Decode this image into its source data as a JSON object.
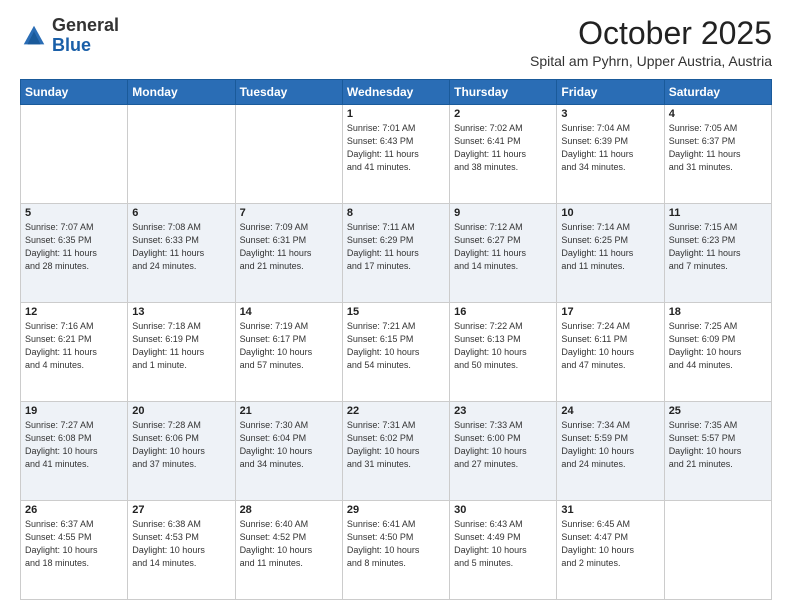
{
  "header": {
    "logo": {
      "general": "General",
      "blue": "Blue"
    },
    "title": "October 2025",
    "location": "Spital am Pyhrn, Upper Austria, Austria"
  },
  "calendar": {
    "days_of_week": [
      "Sunday",
      "Monday",
      "Tuesday",
      "Wednesday",
      "Thursday",
      "Friday",
      "Saturday"
    ],
    "weeks": [
      [
        {
          "day": "",
          "info": ""
        },
        {
          "day": "",
          "info": ""
        },
        {
          "day": "",
          "info": ""
        },
        {
          "day": "1",
          "info": "Sunrise: 7:01 AM\nSunset: 6:43 PM\nDaylight: 11 hours\nand 41 minutes."
        },
        {
          "day": "2",
          "info": "Sunrise: 7:02 AM\nSunset: 6:41 PM\nDaylight: 11 hours\nand 38 minutes."
        },
        {
          "day": "3",
          "info": "Sunrise: 7:04 AM\nSunset: 6:39 PM\nDaylight: 11 hours\nand 34 minutes."
        },
        {
          "day": "4",
          "info": "Sunrise: 7:05 AM\nSunset: 6:37 PM\nDaylight: 11 hours\nand 31 minutes."
        }
      ],
      [
        {
          "day": "5",
          "info": "Sunrise: 7:07 AM\nSunset: 6:35 PM\nDaylight: 11 hours\nand 28 minutes."
        },
        {
          "day": "6",
          "info": "Sunrise: 7:08 AM\nSunset: 6:33 PM\nDaylight: 11 hours\nand 24 minutes."
        },
        {
          "day": "7",
          "info": "Sunrise: 7:09 AM\nSunset: 6:31 PM\nDaylight: 11 hours\nand 21 minutes."
        },
        {
          "day": "8",
          "info": "Sunrise: 7:11 AM\nSunset: 6:29 PM\nDaylight: 11 hours\nand 17 minutes."
        },
        {
          "day": "9",
          "info": "Sunrise: 7:12 AM\nSunset: 6:27 PM\nDaylight: 11 hours\nand 14 minutes."
        },
        {
          "day": "10",
          "info": "Sunrise: 7:14 AM\nSunset: 6:25 PM\nDaylight: 11 hours\nand 11 minutes."
        },
        {
          "day": "11",
          "info": "Sunrise: 7:15 AM\nSunset: 6:23 PM\nDaylight: 11 hours\nand 7 minutes."
        }
      ],
      [
        {
          "day": "12",
          "info": "Sunrise: 7:16 AM\nSunset: 6:21 PM\nDaylight: 11 hours\nand 4 minutes."
        },
        {
          "day": "13",
          "info": "Sunrise: 7:18 AM\nSunset: 6:19 PM\nDaylight: 11 hours\nand 1 minute."
        },
        {
          "day": "14",
          "info": "Sunrise: 7:19 AM\nSunset: 6:17 PM\nDaylight: 10 hours\nand 57 minutes."
        },
        {
          "day": "15",
          "info": "Sunrise: 7:21 AM\nSunset: 6:15 PM\nDaylight: 10 hours\nand 54 minutes."
        },
        {
          "day": "16",
          "info": "Sunrise: 7:22 AM\nSunset: 6:13 PM\nDaylight: 10 hours\nand 50 minutes."
        },
        {
          "day": "17",
          "info": "Sunrise: 7:24 AM\nSunset: 6:11 PM\nDaylight: 10 hours\nand 47 minutes."
        },
        {
          "day": "18",
          "info": "Sunrise: 7:25 AM\nSunset: 6:09 PM\nDaylight: 10 hours\nand 44 minutes."
        }
      ],
      [
        {
          "day": "19",
          "info": "Sunrise: 7:27 AM\nSunset: 6:08 PM\nDaylight: 10 hours\nand 41 minutes."
        },
        {
          "day": "20",
          "info": "Sunrise: 7:28 AM\nSunset: 6:06 PM\nDaylight: 10 hours\nand 37 minutes."
        },
        {
          "day": "21",
          "info": "Sunrise: 7:30 AM\nSunset: 6:04 PM\nDaylight: 10 hours\nand 34 minutes."
        },
        {
          "day": "22",
          "info": "Sunrise: 7:31 AM\nSunset: 6:02 PM\nDaylight: 10 hours\nand 31 minutes."
        },
        {
          "day": "23",
          "info": "Sunrise: 7:33 AM\nSunset: 6:00 PM\nDaylight: 10 hours\nand 27 minutes."
        },
        {
          "day": "24",
          "info": "Sunrise: 7:34 AM\nSunset: 5:59 PM\nDaylight: 10 hours\nand 24 minutes."
        },
        {
          "day": "25",
          "info": "Sunrise: 7:35 AM\nSunset: 5:57 PM\nDaylight: 10 hours\nand 21 minutes."
        }
      ],
      [
        {
          "day": "26",
          "info": "Sunrise: 6:37 AM\nSunset: 4:55 PM\nDaylight: 10 hours\nand 18 minutes."
        },
        {
          "day": "27",
          "info": "Sunrise: 6:38 AM\nSunset: 4:53 PM\nDaylight: 10 hours\nand 14 minutes."
        },
        {
          "day": "28",
          "info": "Sunrise: 6:40 AM\nSunset: 4:52 PM\nDaylight: 10 hours\nand 11 minutes."
        },
        {
          "day": "29",
          "info": "Sunrise: 6:41 AM\nSunset: 4:50 PM\nDaylight: 10 hours\nand 8 minutes."
        },
        {
          "day": "30",
          "info": "Sunrise: 6:43 AM\nSunset: 4:49 PM\nDaylight: 10 hours\nand 5 minutes."
        },
        {
          "day": "31",
          "info": "Sunrise: 6:45 AM\nSunset: 4:47 PM\nDaylight: 10 hours\nand 2 minutes."
        },
        {
          "day": "",
          "info": ""
        }
      ]
    ]
  }
}
